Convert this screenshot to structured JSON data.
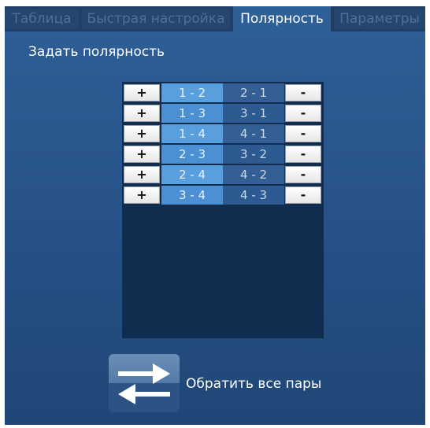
{
  "tabs": [
    {
      "label": "Таблица",
      "active": false
    },
    {
      "label": "Быстрая настройка",
      "active": false
    },
    {
      "label": "Полярность",
      "active": true
    },
    {
      "label": "Параметры",
      "active": false
    }
  ],
  "polarity": {
    "section_label": "Задать полярность",
    "plus_label": "+",
    "minus_label": "-",
    "pairs": [
      {
        "forward": "1 - 2",
        "reverse": "2 - 1"
      },
      {
        "forward": "1 - 3",
        "reverse": "3 - 1"
      },
      {
        "forward": "1 - 4",
        "reverse": "4 - 1"
      },
      {
        "forward": "2 - 3",
        "reverse": "3 - 2"
      },
      {
        "forward": "2 - 4",
        "reverse": "4 - 2"
      },
      {
        "forward": "3 - 4",
        "reverse": "4 - 3"
      }
    ]
  },
  "reverse_all": {
    "label": "Обратить все пары",
    "icon": "swap-arrows-icon"
  },
  "colors": {
    "window_bg": "#2f5f97",
    "panel_bg": "#102c4e",
    "forward_cell": "#4a90d2",
    "reverse_cell": "#2d5a90"
  }
}
